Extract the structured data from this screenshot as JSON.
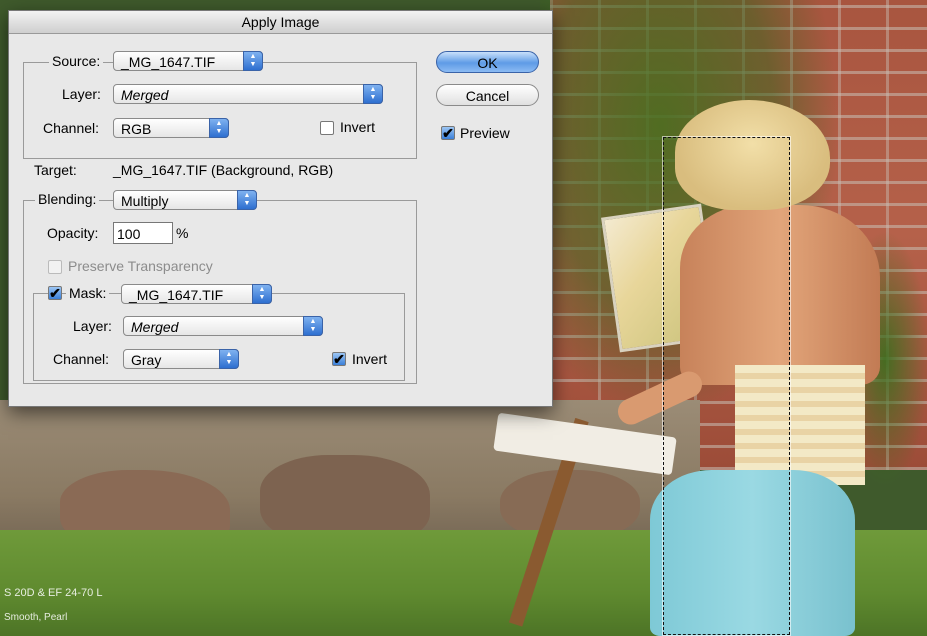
{
  "dialog": {
    "title": "Apply Image",
    "source": {
      "label": "Source:",
      "value": "_MG_1647.TIF"
    },
    "layer": {
      "label": "Layer:",
      "value": "Merged"
    },
    "channel": {
      "label": "Channel:",
      "value": "RGB"
    },
    "invert": {
      "label": "Invert",
      "checked": false
    },
    "target": {
      "label": "Target:",
      "value": "_MG_1647.TIF (Background, RGB)"
    },
    "blending": {
      "label": "Blending:",
      "value": "Multiply"
    },
    "opacity": {
      "label": "Opacity:",
      "value": "100",
      "unit": "%"
    },
    "preserve_transparency": {
      "label": "Preserve Transparency",
      "checked": false,
      "enabled": false
    },
    "mask": {
      "label": "Mask:",
      "checked": true,
      "value": "_MG_1647.TIF",
      "layer": {
        "label": "Layer:",
        "value": "Merged"
      },
      "channel": {
        "label": "Channel:",
        "value": "Gray"
      },
      "invert": {
        "label": "Invert",
        "checked": true
      }
    },
    "ok_label": "OK",
    "cancel_label": "Cancel",
    "preview": {
      "label": "Preview",
      "checked": true
    }
  },
  "photo": {
    "watermark_line1": "S 20D & EF 24-70 L",
    "watermark_line2": "Smooth, Pearl"
  },
  "icons": {
    "popup_arrows": "▲▼",
    "checkmark": "✔"
  }
}
